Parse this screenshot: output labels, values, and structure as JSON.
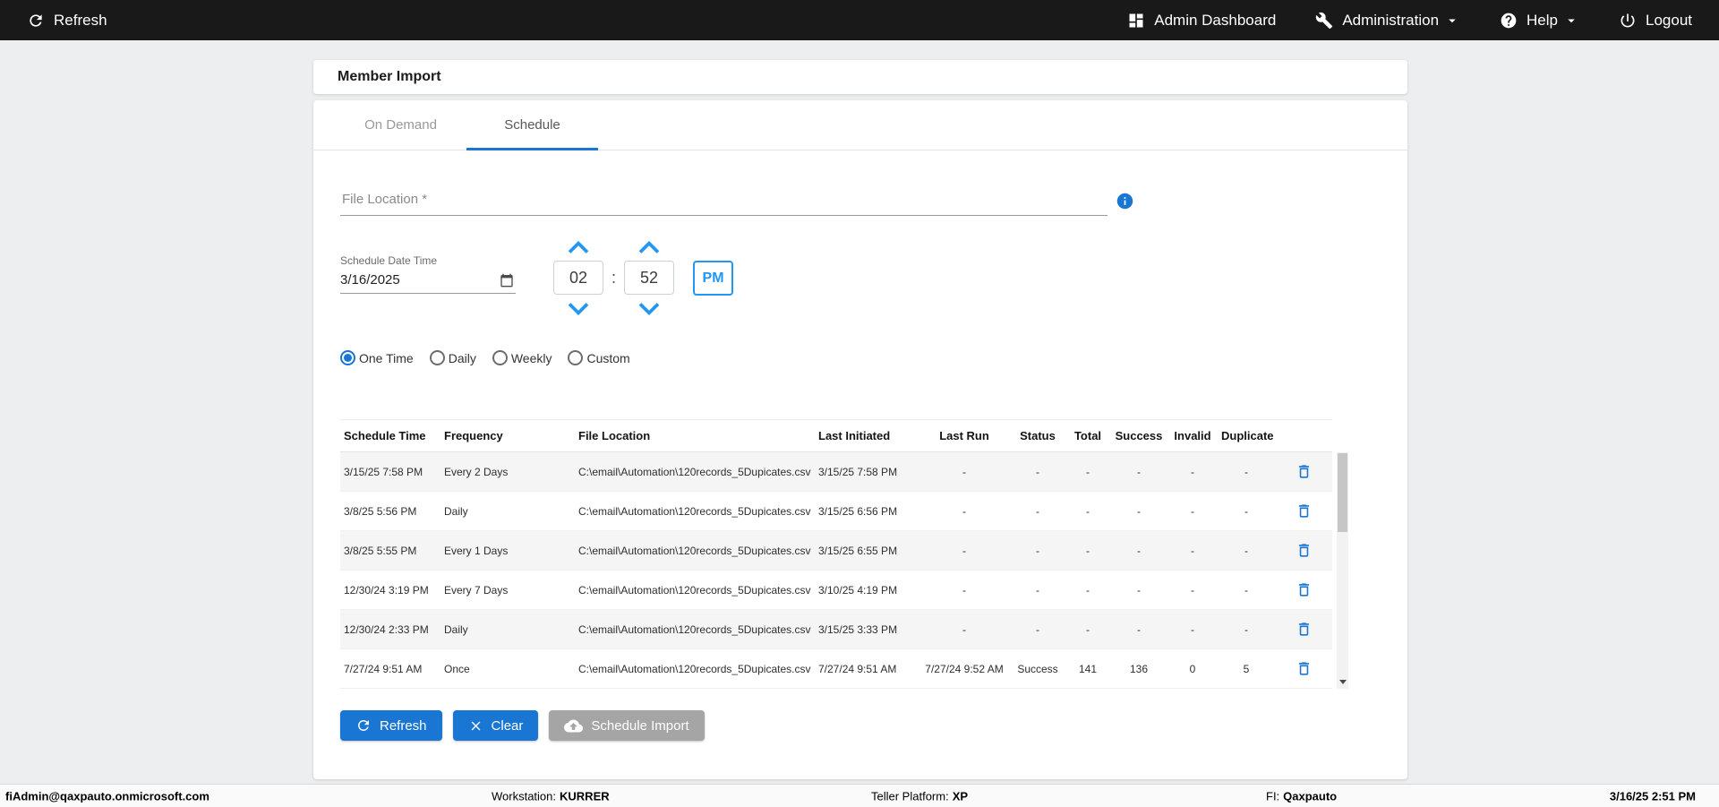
{
  "topbar": {
    "refresh": "Refresh",
    "admin_dashboard": "Admin Dashboard",
    "administration": "Administration",
    "help": "Help",
    "logout": "Logout"
  },
  "page": {
    "title": "Member Import"
  },
  "tabs": [
    {
      "label": "On Demand",
      "active": false
    },
    {
      "label": "Schedule",
      "active": true
    }
  ],
  "form": {
    "file_location_placeholder": "File Location *",
    "schedule_date_time_label": "Schedule Date Time",
    "date_value": "3/16/2025",
    "time": {
      "hour": "02",
      "minute": "52",
      "meridiem": "PM"
    },
    "frequency_options": [
      {
        "label": "One Time",
        "selected": true
      },
      {
        "label": "Daily",
        "selected": false
      },
      {
        "label": "Weekly",
        "selected": false
      },
      {
        "label": "Custom",
        "selected": false
      }
    ]
  },
  "table": {
    "columns": [
      "Schedule Time",
      "Frequency",
      "File Location",
      "Last Initiated",
      "Last Run",
      "Status",
      "Total",
      "Success",
      "Invalid",
      "Duplicate"
    ],
    "rows": [
      {
        "schedule_time": "3/15/25 7:58 PM",
        "frequency": "Every 2 Days",
        "file_location": "C:\\email\\Automation\\120records_5Dupicates.csv",
        "last_initiated": "3/15/25 7:58 PM",
        "last_run": "-",
        "status": "-",
        "total": "-",
        "success": "-",
        "invalid": "-",
        "duplicate": "-"
      },
      {
        "schedule_time": "3/8/25 5:56 PM",
        "frequency": "Daily",
        "file_location": "C:\\email\\Automation\\120records_5Dupicates.csv",
        "last_initiated": "3/15/25 6:56 PM",
        "last_run": "-",
        "status": "-",
        "total": "-",
        "success": "-",
        "invalid": "-",
        "duplicate": "-"
      },
      {
        "schedule_time": "3/8/25 5:55 PM",
        "frequency": "Every 1 Days",
        "file_location": "C:\\email\\Automation\\120records_5Dupicates.csv",
        "last_initiated": "3/15/25 6:55 PM",
        "last_run": "-",
        "status": "-",
        "total": "-",
        "success": "-",
        "invalid": "-",
        "duplicate": "-"
      },
      {
        "schedule_time": "12/30/24 3:19 PM",
        "frequency": "Every 7 Days",
        "file_location": "C:\\email\\Automation\\120records_5Dupicates.csv",
        "last_initiated": "3/10/25 4:19 PM",
        "last_run": "-",
        "status": "-",
        "total": "-",
        "success": "-",
        "invalid": "-",
        "duplicate": "-"
      },
      {
        "schedule_time": "12/30/24 2:33 PM",
        "frequency": "Daily",
        "file_location": "C:\\email\\Automation\\120records_5Dupicates.csv",
        "last_initiated": "3/15/25 3:33 PM",
        "last_run": "-",
        "status": "-",
        "total": "-",
        "success": "-",
        "invalid": "-",
        "duplicate": "-"
      },
      {
        "schedule_time": "7/27/24 9:51 AM",
        "frequency": "Once",
        "file_location": "C:\\email\\Automation\\120records_5Dupicates.csv",
        "last_initiated": "7/27/24 9:51 AM",
        "last_run": "7/27/24 9:52 AM",
        "status": "Success",
        "total": "141",
        "success": "136",
        "invalid": "0",
        "duplicate": "5"
      }
    ]
  },
  "actions": {
    "refresh": "Refresh",
    "clear": "Clear",
    "schedule_import": "Schedule Import"
  },
  "footer": {
    "user": "fiAdmin@qaxpauto.onmicrosoft.com",
    "workstation_label": "Workstation:",
    "workstation_value": "KURRER",
    "teller_platform_label": "Teller Platform:",
    "teller_platform_value": "XP",
    "fi_label": "FI:",
    "fi_value": "Qaxpauto",
    "datetime": "3/16/25 2:51 PM"
  },
  "colors": {
    "accent_blue": "#1976d2",
    "spinner_blue": "#2196f3",
    "topbar_bg": "#191919",
    "disabled_button": "#a5a5a5",
    "row_stripe": "#f5f5f5"
  }
}
